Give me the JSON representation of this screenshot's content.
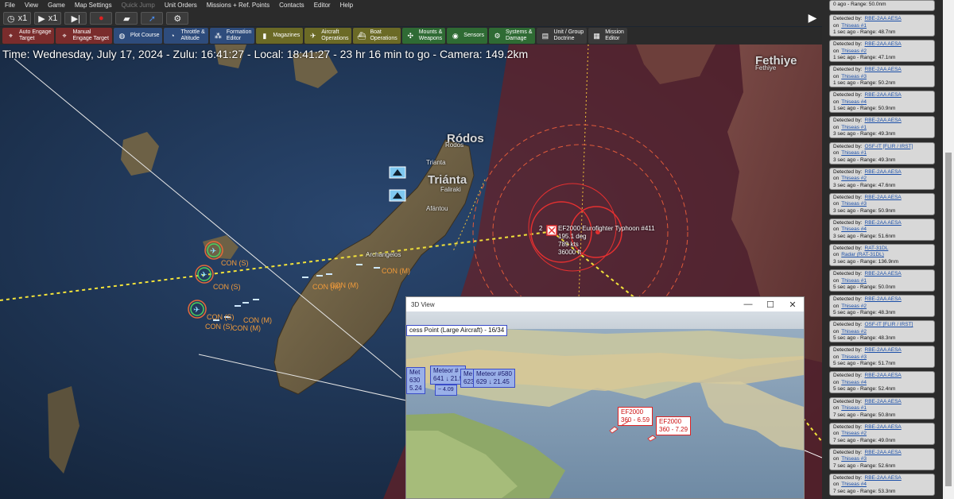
{
  "menu": [
    "File",
    "View",
    "Game",
    "Map Settings",
    "Quick Jump",
    "Unit Orders",
    "Missions + Ref. Points",
    "Contacts",
    "Editor",
    "Help"
  ],
  "menu_disabled": [
    "Quick Jump"
  ],
  "time_controls": {
    "speed1": "x1",
    "speed2": "x1"
  },
  "toolbar": [
    {
      "label1": "Auto Engage",
      "label2": "Target",
      "style": "red",
      "icon": "target-icon"
    },
    {
      "label1": "Manual",
      "label2": "Engage Target",
      "style": "red",
      "icon": "target-icon"
    },
    {
      "label1": "Plot Course",
      "label2": "",
      "style": "blue",
      "icon": "globe-icon"
    },
    {
      "label1": "Throttle &",
      "label2": "Altitude",
      "style": "blue",
      "icon": "gauge-icon"
    },
    {
      "label1": "Formation",
      "label2": "Editor",
      "style": "blue",
      "icon": "formation-icon"
    },
    {
      "label1": "Magazines",
      "label2": "",
      "style": "olive",
      "icon": "ammo-icon"
    },
    {
      "label1": "Aircraft",
      "label2": "Operations",
      "style": "olive",
      "icon": "aircraft-icon"
    },
    {
      "label1": "Boat",
      "label2": "Operations",
      "style": "olive",
      "icon": "boat-icon"
    },
    {
      "label1": "Mounts &",
      "label2": "Weapons",
      "style": "green",
      "icon": "mount-icon"
    },
    {
      "label1": "Sensors",
      "label2": "",
      "style": "green",
      "icon": "sensor-icon"
    },
    {
      "label1": "Systems &",
      "label2": "Damage",
      "style": "green",
      "icon": "gear-icon"
    },
    {
      "label1": "Unit / Group",
      "label2": "Doctrine",
      "style": "grey",
      "icon": "doctrine-icon"
    },
    {
      "label1": "Mission",
      "label2": "Editor",
      "style": "grey",
      "icon": "mission-icon"
    }
  ],
  "timeline": "Time: Wednesday, July 17, 2024 - Zulu: 16:41:27 - Local: 18:41:27 - 23 hr 16 min to go - Camera: 149.2km",
  "map_labels": {
    "rodos_small": "Rodos",
    "rodos_big": "Ródos",
    "trianta_small": "Trianta",
    "trianta_big": "Triánta",
    "fallraki": "Faliraki",
    "afantou": "Afántou",
    "archangelos": "Archángelos",
    "fethiye_big": "Fethiye",
    "fethiye_small": "Fethiye"
  },
  "con_labels": [
    "CON (S)",
    "CON (S)",
    "CON (S)",
    "CON (S)",
    "CON (M)",
    "CON (M)",
    "CON (M)",
    "CON (M)",
    "CON (M)"
  ],
  "unit": {
    "name": "EF2000 Eurofighter Typhoon #411",
    "heading": "195.1 deg",
    "speed": "789 kts",
    "altitude": "36000 ft",
    "count": "2"
  },
  "view3d": {
    "title": "3D View",
    "tag_access": "cess Point (Large Aircraft) - 16/34",
    "meteor_tags": [
      {
        "line1": "Met",
        "line2": "630",
        "line3": "5.24"
      },
      {
        "line1": "Meteor #",
        "line2": "641 ↓ 21.5",
        "line3": ""
      },
      {
        "line1": "Me",
        "line2": "623",
        "line3": ""
      },
      {
        "line1": "Meteor #580",
        "line2": "629 ↓ 21.45",
        "line3": ""
      }
    ],
    "ef_tags": [
      {
        "line1": "EF2000",
        "line2": "360 - 6.59"
      },
      {
        "line1": "EF2000",
        "line2": "360 - 7.29"
      }
    ],
    "small_tag": "~ 4.09"
  },
  "messages": [
    {
      "by": "",
      "on": "",
      "ago": "0 ago",
      "range": "Range: 50.0nm"
    },
    {
      "by": "RBE-2AA AESA",
      "on": "Thiseas #1",
      "ago": "1 sec ago",
      "range": "Range: 48.7nm"
    },
    {
      "by": "RBE-2AA AESA",
      "on": "Thiseas #2",
      "ago": "1 sec ago",
      "range": "Range: 47.1nm"
    },
    {
      "by": "RBE-2AA AESA",
      "on": "Thiseas #3",
      "ago": "1 sec ago",
      "range": "Range: 50.2nm"
    },
    {
      "by": "RBE-2AA AESA",
      "on": "Thiseas #4",
      "ago": "1 sec ago",
      "range": "Range: 50.9nm"
    },
    {
      "by": "RBE-2AA AESA",
      "on": "Thiseas #1",
      "ago": "3 sec ago",
      "range": "Range: 49.3nm"
    },
    {
      "by": "OSF-IT [FLIR / IRST]",
      "on": "Thiseas #1",
      "ago": "3 sec ago",
      "range": "Range: 49.3nm"
    },
    {
      "by": "RBE-2AA AESA",
      "on": "Thiseas #2",
      "ago": "3 sec ago",
      "range": "Range: 47.6nm"
    },
    {
      "by": "RBE-2AA AESA",
      "on": "Thiseas #3",
      "ago": "3 sec ago",
      "range": "Range: 50.9nm"
    },
    {
      "by": "RBE-2AA AESA",
      "on": "Thiseas #4",
      "ago": "3 sec ago",
      "range": "Range: 51.6nm"
    },
    {
      "by": "RAT-31DL",
      "on": "Radar (RAT-31DL)",
      "ago": "3 sec ago",
      "range": "Range: 136.9nm"
    },
    {
      "by": "RBE-2AA AESA",
      "on": "Thiseas #1",
      "ago": "5 sec ago",
      "range": "Range: 50.0nm"
    },
    {
      "by": "RBE-2AA AESA",
      "on": "Thiseas #2",
      "ago": "5 sec ago",
      "range": "Range: 48.3nm"
    },
    {
      "by": "OSF-IT [FLIR / IRST]",
      "on": "Thiseas #2",
      "ago": "5 sec ago",
      "range": "Range: 48.3nm"
    },
    {
      "by": "RBE-2AA AESA",
      "on": "Thiseas #3",
      "ago": "5 sec ago",
      "range": "Range: 51.7nm"
    },
    {
      "by": "RBE-2AA AESA",
      "on": "Thiseas #4",
      "ago": "5 sec ago",
      "range": "Range: 52.4nm"
    },
    {
      "by": "RBE-2AA AESA",
      "on": "Thiseas #1",
      "ago": "7 sec ago",
      "range": "Range: 50.8nm"
    },
    {
      "by": "RBE-2AA AESA",
      "on": "Thiseas #2",
      "ago": "7 sec ago",
      "range": "Range: 49.0nm"
    },
    {
      "by": "RBE-2AA AESA",
      "on": "Thiseas #3",
      "ago": "7 sec ago",
      "range": "Range: 52.6nm"
    },
    {
      "by": "RBE-2AA AESA",
      "on": "Thiseas #4",
      "ago": "7 sec ago",
      "range": "Range: 53.3nm"
    }
  ],
  "msg_prefix": {
    "by": "Detected by:",
    "on": "on"
  },
  "colors": {
    "enemy_zone": "#6a1f24",
    "con_orange": "#f29b3a",
    "track_yellow": "#f2e23a"
  }
}
